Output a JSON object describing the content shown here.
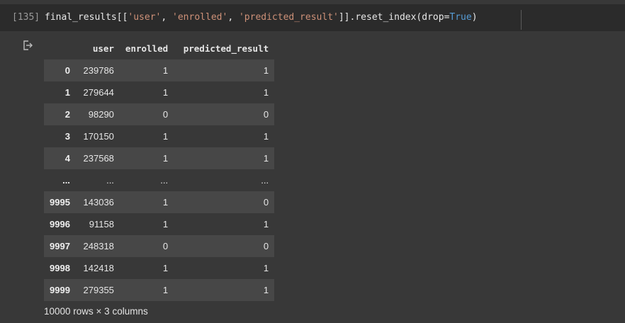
{
  "cell": {
    "execution_count": "[135]",
    "code": {
      "prefix": "final_results[[",
      "str1": "'user'",
      "sep1": ", ",
      "str2": "'enrolled'",
      "sep2": ", ",
      "str3": "'predicted_result'",
      "mid": "]].reset_index(drop=",
      "kw": "True",
      "suffix": ")"
    },
    "output_icon": "output-redirect-icon"
  },
  "dataframe": {
    "columns": [
      "",
      "user",
      "enrolled",
      "predicted_result"
    ],
    "rows": [
      {
        "index": "0",
        "user": "239786",
        "enrolled": "1",
        "predicted_result": "1"
      },
      {
        "index": "1",
        "user": "279644",
        "enrolled": "1",
        "predicted_result": "1"
      },
      {
        "index": "2",
        "user": "98290",
        "enrolled": "0",
        "predicted_result": "0"
      },
      {
        "index": "3",
        "user": "170150",
        "enrolled": "1",
        "predicted_result": "1"
      },
      {
        "index": "4",
        "user": "237568",
        "enrolled": "1",
        "predicted_result": "1"
      },
      {
        "index": "...",
        "user": "...",
        "enrolled": "...",
        "predicted_result": "..."
      },
      {
        "index": "9995",
        "user": "143036",
        "enrolled": "1",
        "predicted_result": "0"
      },
      {
        "index": "9996",
        "user": "91158",
        "enrolled": "1",
        "predicted_result": "1"
      },
      {
        "index": "9997",
        "user": "248318",
        "enrolled": "0",
        "predicted_result": "0"
      },
      {
        "index": "9998",
        "user": "142418",
        "enrolled": "1",
        "predicted_result": "1"
      },
      {
        "index": "9999",
        "user": "279355",
        "enrolled": "1",
        "predicted_result": "1"
      }
    ],
    "shape_note": "10000 rows × 3 columns"
  },
  "colors": {
    "background": "#383838",
    "code_background": "#2b2b2b",
    "stripe_row": "#474747",
    "string": "#ce9178",
    "keyword": "#569cd6"
  }
}
